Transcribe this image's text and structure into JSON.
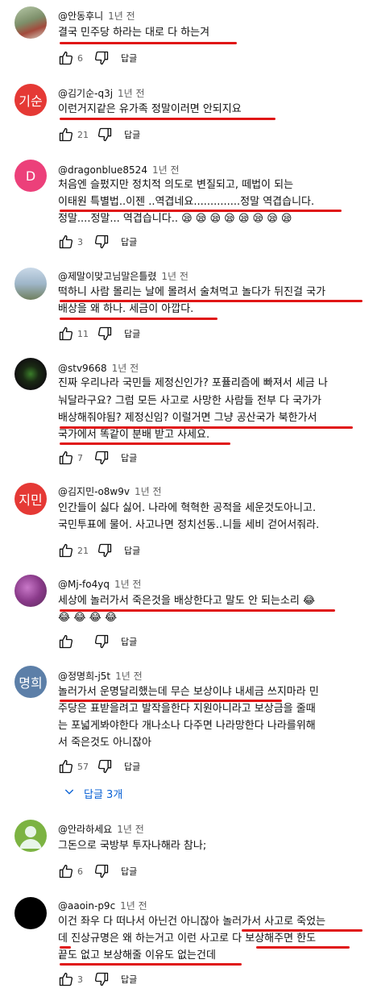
{
  "reply_label": "답글",
  "comments": [
    {
      "author": "@안동후니",
      "time": "1년 전",
      "lines": [
        "결국 민주당  하라는 대로 다 하는겨"
      ],
      "likes": "6"
    },
    {
      "author": "@김기순-q3j",
      "time": "1년 전",
      "avatar_text": "기순",
      "lines": [
        "이런거지같은  유가족  정말이러면 안되지요"
      ],
      "likes": "21"
    },
    {
      "author": "@dragonblue8524",
      "time": "1년 전",
      "avatar_text": "D",
      "lines": [
        "처음엔 슬펐지만 정치적 의도로 변질되고, 떼법이 되는",
        "이태원 특별법..이젠 ..역겹네요..............정말 역겹습니다.",
        "정말....정말... 역겹습니다.. 😪 😪 😪 😪 😪 😪 😪 😪"
      ],
      "likes": "3"
    },
    {
      "author": "@제말이맞고님말은틀렸",
      "time": "1년 전",
      "lines": [
        "떡하니 사람 몰리는 날에 몰려서 술쳐먹고 놀다가 뒤진걸 국가",
        "배상을 왜 하나. 세금이 아깝다."
      ],
      "likes": "11"
    },
    {
      "author": "@stv9668",
      "time": "1년 전",
      "lines": [
        "진짜 우리나라 국민들 제정신인가? 포퓰리즘에 빠져서 세금 나",
        "눠달라구요? 그럼 모든 사고로 사망한 사람들 전부 다 국가가",
        "배상해줘야됨? 제정신임? 이럴거면 그냥 공산국가 북한가서",
        "국가에서 똑같이 분배 받고 사세요."
      ],
      "likes": "7"
    },
    {
      "author": "@김지민-o8w9v",
      "time": "1년 전",
      "avatar_text": "지민",
      "lines": [
        "인간들이 싫다 싫어. 나라에 혁혁한 공적을 세운것도아니고.",
        "국민투표에 물어. 사고나면 정치선동..니들 세비 걷어서줘라."
      ],
      "likes": "21"
    },
    {
      "author": "@Mj-fo4yq",
      "time": "1년 전",
      "lines": [
        "세상에 놀러가서 죽은것을 배상한다고 말도 안 되는소리 😂",
        "😂 😂 😂 😂"
      ],
      "likes": ""
    },
    {
      "author": "@정명희-j5t",
      "time": "1년 전",
      "avatar_text": "명희",
      "lines": [
        "놀러가서 운명달리했는데 무슨 보상이냐 내세금 쓰지마라 민",
        "주당은 표받을려고 발작을한다 지원아니라고 보상금을 줄때",
        "는 포넓게봐야한다 개나소나 다주면 나라망한다 나라를위해",
        "서 죽은것도 아니잖아"
      ],
      "likes": "57",
      "replies": "답글 3개"
    },
    {
      "author": "@안라하세요",
      "time": "1년 전",
      "lines": [
        "그돈으로 국방부  투자나해라 참나;"
      ],
      "likes": "6"
    },
    {
      "author": "@aaoin-p9c",
      "time": "1년 전",
      "lines": [
        "이건 좌우 다 떠나서 아닌건 아니잖아 놀러가서 사고로 죽었는",
        "데 진상규명은 왜 하는거고 이런 사고로 다 보상해주면 한도",
        "끝도 없고 보상해줄 이유도 없는건데"
      ],
      "likes": "3"
    }
  ]
}
